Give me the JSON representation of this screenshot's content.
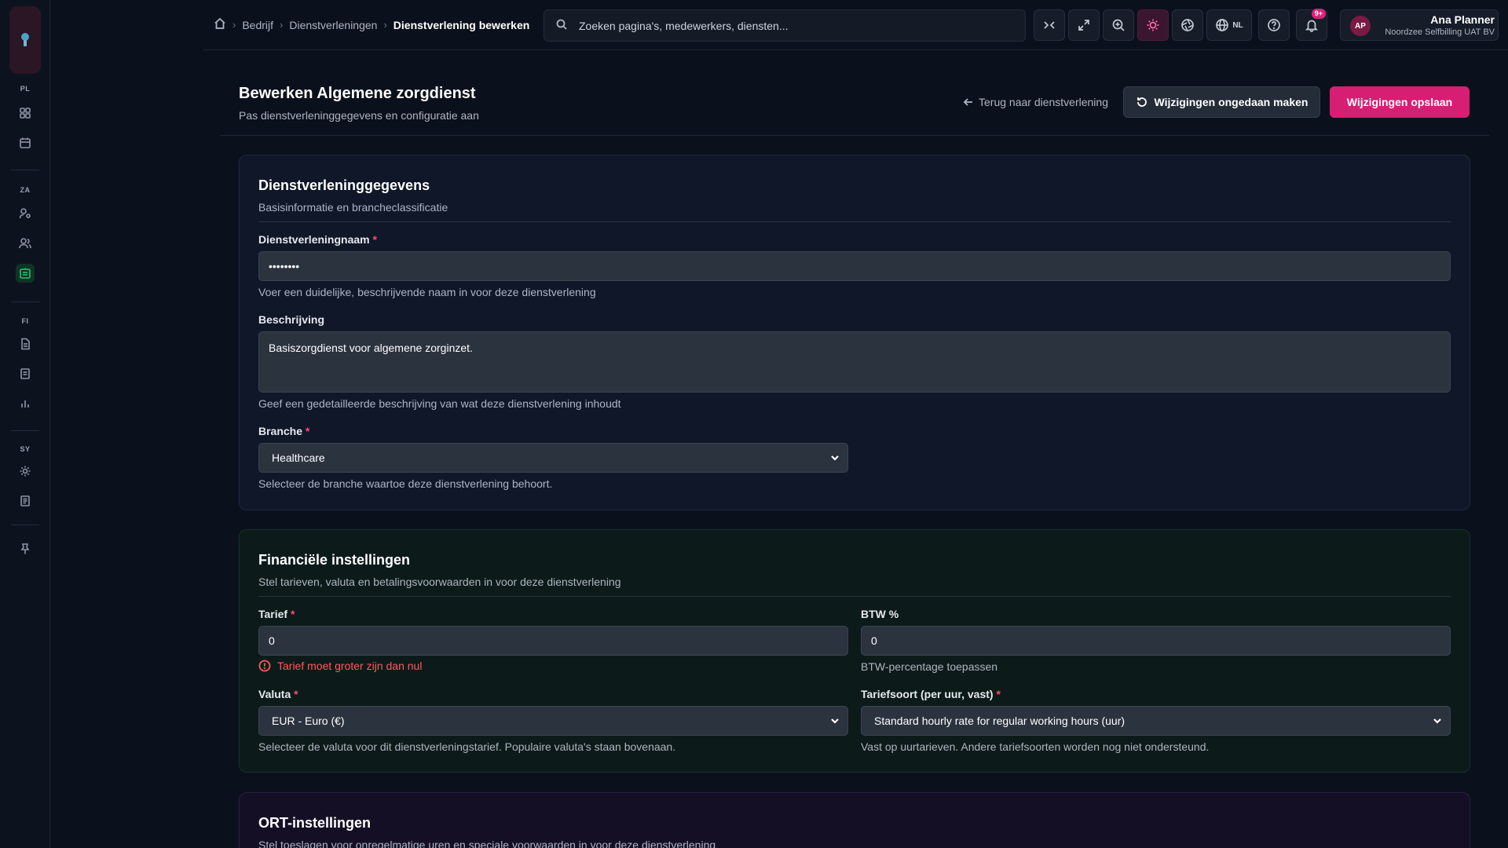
{
  "breadcrumb": {
    "items": [
      "Bedrijf",
      "Dienstverleningen"
    ],
    "current": "Dienstverlening bewerken"
  },
  "search": {
    "placeholder": "Zoeken pagina's, medewerkers, diensten..."
  },
  "toolbar": {
    "language": "NL",
    "notification_count": "9+"
  },
  "user": {
    "initials": "AP",
    "name": "Ana Planner",
    "org": "Noordzee Selfbilling UAT BV"
  },
  "sidebar": {
    "groups": [
      "PL",
      "ZA",
      "FI",
      "SY"
    ]
  },
  "page": {
    "title": "Bewerken Algemene zorgdienst",
    "subtitle": "Pas dienstverleninggegevens en configuratie aan",
    "back_label": "Terug naar dienstverlening",
    "undo_label": "Wijzigingen ongedaan maken",
    "save_label": "Wijzigingen opslaan"
  },
  "details": {
    "title": "Dienstverleninggegevens",
    "subtitle": "Basisinformatie en brancheclassificatie",
    "name_label": "Dienstverleningnaam",
    "name_value": "••••••••",
    "name_help": "Voer een duidelijke, beschrijvende naam in voor deze dienstverlening",
    "description_label": "Beschrijving",
    "description_value": "Basiszorgdienst voor algemene zorginzet.",
    "description_help": "Geef een gedetailleerde beschrijving van wat deze dienstverlening inhoudt",
    "branche_label": "Branche",
    "branche_value": "Healthcare",
    "branche_help": "Selecteer de branche waartoe deze dienstverlening behoort."
  },
  "financial": {
    "title": "Financiële instellingen",
    "subtitle": "Stel tarieven, valuta en betalingsvoorwaarden in voor deze dienstverlening",
    "tarief_label": "Tarief",
    "tarief_value": "0",
    "tarief_error": "Tarief moet groter zijn dan nul",
    "btw_label": "BTW %",
    "btw_value": "0",
    "btw_help": "BTW-percentage toepassen",
    "valuta_label": "Valuta",
    "valuta_value": "EUR - Euro (€)",
    "valuta_help": "Selecteer de valuta voor dit dienstverleningstarief. Populaire valuta's staan bovenaan.",
    "tariefsoort_label": "Tariefsoort (per uur, vast)",
    "tariefsoort_value": "Standard hourly rate for regular working hours (uur)",
    "tariefsoort_help": "Vast op uurtarieven. Andere tariefsoorten worden nog niet ondersteund."
  },
  "ort": {
    "title": "ORT-instellingen",
    "subtitle": "Stel toeslagen voor onregelmatige uren en speciale voorwaarden in voor deze dienstverlening"
  },
  "colors": {
    "accent": "#d61f73",
    "error": "#ff5a5a",
    "active_nav": "#27c17a"
  }
}
